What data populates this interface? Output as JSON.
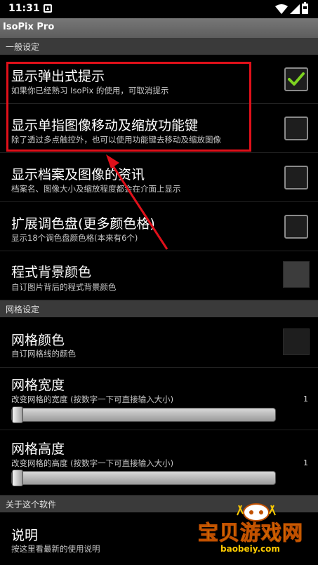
{
  "status_bar": {
    "time": "11:31",
    "notification_icon": "notification-icon",
    "wifi_icon": "wifi-icon",
    "signal_icon": "signal-icon",
    "battery_icon": "battery-icon"
  },
  "app": {
    "title": "IsoPix Pro"
  },
  "sections": {
    "general": {
      "header": "一般设定",
      "items": [
        {
          "title": "显示弹出式提示",
          "summary": "如果你已经熟习 IsoPix 的使用，可取消提示",
          "checked": true
        },
        {
          "title": "显示单指图像移动及缩放功能键",
          "summary": "除了透过多点触控外，也可以使用功能键去移动及缩放图像",
          "checked": false
        },
        {
          "title": "显示档案及图像的资讯",
          "summary": "档案名、图像大小及缩放程度都会在介面上显示",
          "checked": false
        },
        {
          "title": "扩展调色盘(更多颜色格)",
          "summary": "显示18个调色盘颜色格(本来有6个)",
          "checked": false
        },
        {
          "title": "程式背景颜色",
          "summary": "自订图片背后的程式背景颜色",
          "swatch_color": "#3c3c3c"
        }
      ]
    },
    "grid": {
      "header": "网格设定",
      "color": {
        "title": "网格颜色",
        "summary": "自订网格线的颜色",
        "swatch_color": "#1e1e1e"
      },
      "width": {
        "title": "网格宽度",
        "summary": "改变网格的宽度 (按数字一下可直接输入大小)",
        "value": "1"
      },
      "height": {
        "title": "网格高度",
        "summary": "改变网格的高度 (按数字一下可直接输入大小)",
        "value": "1"
      }
    },
    "about": {
      "header": "关于这个软件",
      "help": {
        "title": "说明",
        "summary": "按这里看最新的使用说明"
      }
    }
  },
  "watermark": {
    "brand": "宝贝游戏网",
    "url": "baobeiy.com"
  },
  "colors": {
    "highlight": "#e0101a",
    "check": "#7ed321",
    "watermark": "#ffcc00"
  }
}
